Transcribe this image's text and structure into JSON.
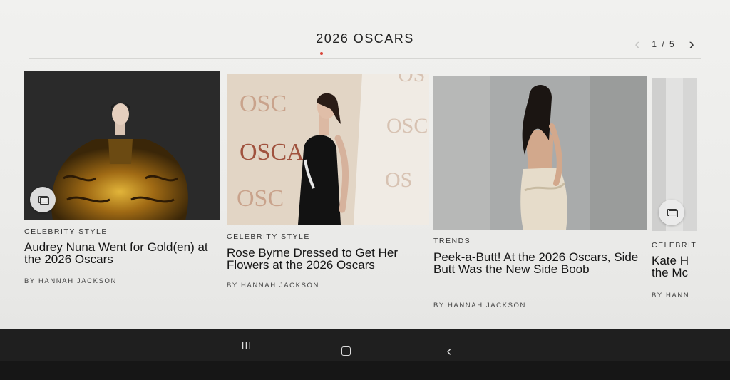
{
  "section": {
    "title": "2026 OSCARS"
  },
  "pager": {
    "prev_icon": "chevron-left-icon",
    "current": "1 / 5",
    "next_icon": "chevron-right-icon"
  },
  "cards": [
    {
      "category": "CELEBRITY STYLE",
      "headline": "Audrey Nuna Went for Gold(en) at the 2026 Oscars",
      "byline": "BY HANNAH JACKSON",
      "image": "photo of woman in voluminous gold ruffled gown on dark background",
      "badge_icon": "gallery-icon"
    },
    {
      "category": "CELEBRITY STYLE",
      "headline": "Rose Byrne Dressed to Get Her Flowers at the 2026 Oscars",
      "byline": "BY HANNAH JACKSON",
      "image": "photo of woman in black gown in front of OSCARS backdrop",
      "backdrop": [
        "OSC",
        "OSCAR",
        "OSC",
        "OSC",
        "OS",
        "OS"
      ]
    },
    {
      "category": "TRENDS",
      "headline": "Peek-a-Butt! At the 2026 Oscars, Side Butt Was the New Side Boob",
      "byline": "BY HANNAH JACKSON",
      "image": "photo of woman in backless champagne gown on grey background"
    },
    {
      "category": "CELEBRIT",
      "headline": "Kate H the Mc",
      "byline": "BY HANN",
      "image": "partially visible photo",
      "badge_icon": "gallery-icon"
    }
  ],
  "system_nav": {
    "recents_label": "III",
    "home_icon": "home-icon",
    "back_label": "‹"
  }
}
